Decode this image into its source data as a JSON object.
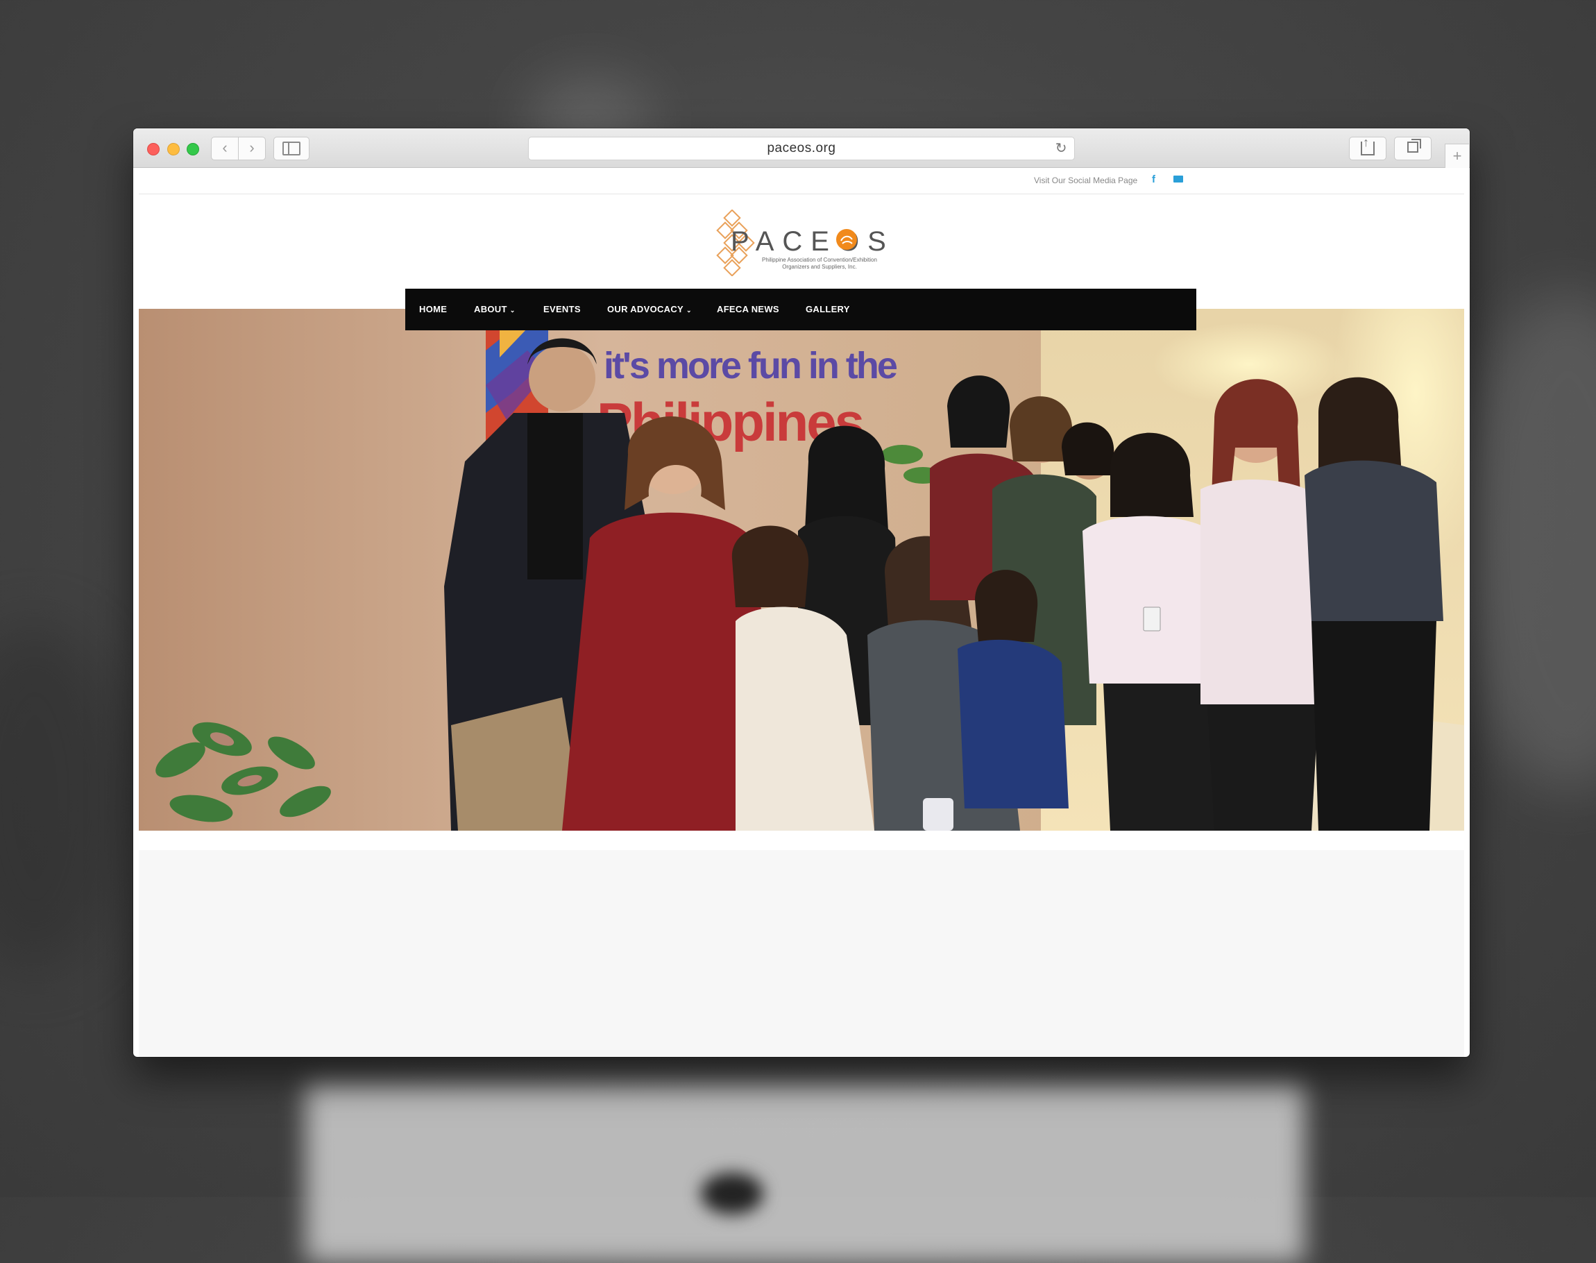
{
  "browser": {
    "url": "paceos.org",
    "back_icon": "‹",
    "forward_icon": "›",
    "reload_icon": "↻",
    "new_tab_icon": "+"
  },
  "site": {
    "topbar": {
      "social_text": "Visit Our Social Media Page",
      "facebook_icon": "f"
    },
    "logo": {
      "wordmark": "PACEOS",
      "tagline": "Philippine Association of Convention/Exhibition Organizers and Suppliers, Inc."
    },
    "nav": {
      "items": [
        {
          "label": "HOME"
        },
        {
          "label": "ABOUT",
          "chevron": "⌄"
        },
        {
          "label": "EVENTS"
        },
        {
          "label": "OUR ADVOCACY",
          "chevron": "⌄"
        },
        {
          "label": "AFECA NEWS"
        },
        {
          "label": "GALLERY"
        }
      ]
    },
    "hero": {
      "sign_line1": "it's more fun in the",
      "sign_line2": "Philippines"
    }
  },
  "colors": {
    "nav_bg": "#0b0b0b",
    "accent_orange": "#f18a1c",
    "social_blue": "#2a9fd8"
  }
}
